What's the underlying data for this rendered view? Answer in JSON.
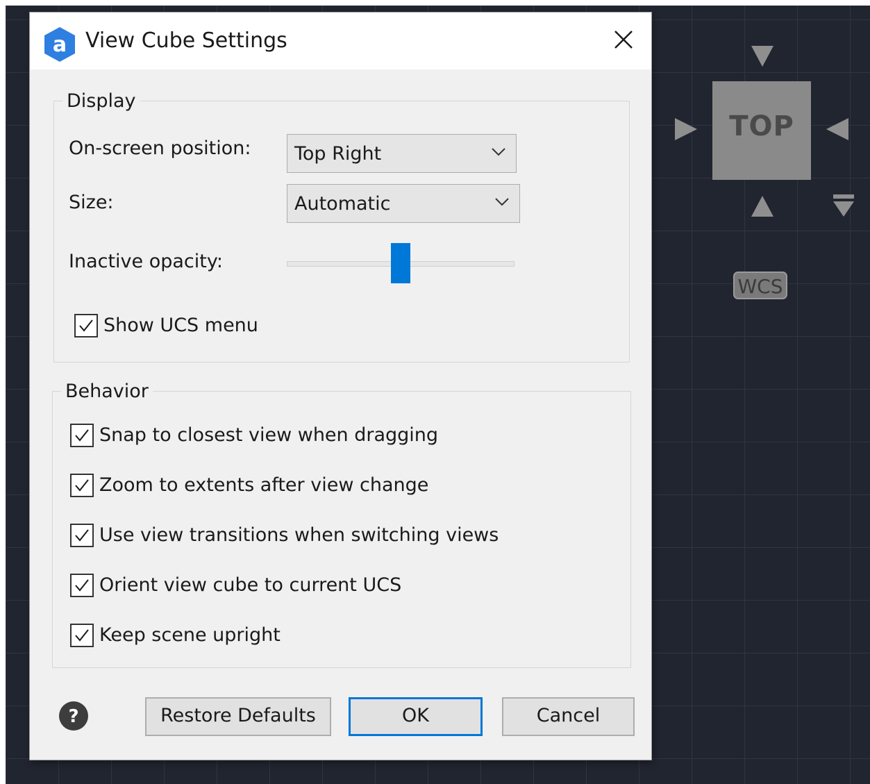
{
  "viewcube": {
    "face_label": "TOP",
    "coordinate_system_label": "WCS"
  },
  "dialog": {
    "title": "View Cube Settings",
    "display": {
      "legend": "Display",
      "position_label": "On-screen position:",
      "position_value": "Top Right",
      "size_label": "Size:",
      "size_value": "Automatic",
      "opacity_label": "Inactive opacity:",
      "opacity_fraction": 0.5,
      "show_ucs_menu_label": "Show UCS menu",
      "show_ucs_menu_checked": true
    },
    "behavior": {
      "legend": "Behavior",
      "options": [
        {
          "label": "Snap to closest view when dragging",
          "checked": true
        },
        {
          "label": "Zoom to extents after view change",
          "checked": true
        },
        {
          "label": "Use view transitions when switching views",
          "checked": true
        },
        {
          "label": "Orient view cube to current UCS",
          "checked": true
        },
        {
          "label": "Keep scene upright",
          "checked": true
        }
      ]
    },
    "buttons": {
      "restore": "Restore Defaults",
      "ok": "OK",
      "cancel": "Cancel"
    }
  },
  "colors": {
    "accent": "#0078d7",
    "viewport_background": "#212530"
  }
}
